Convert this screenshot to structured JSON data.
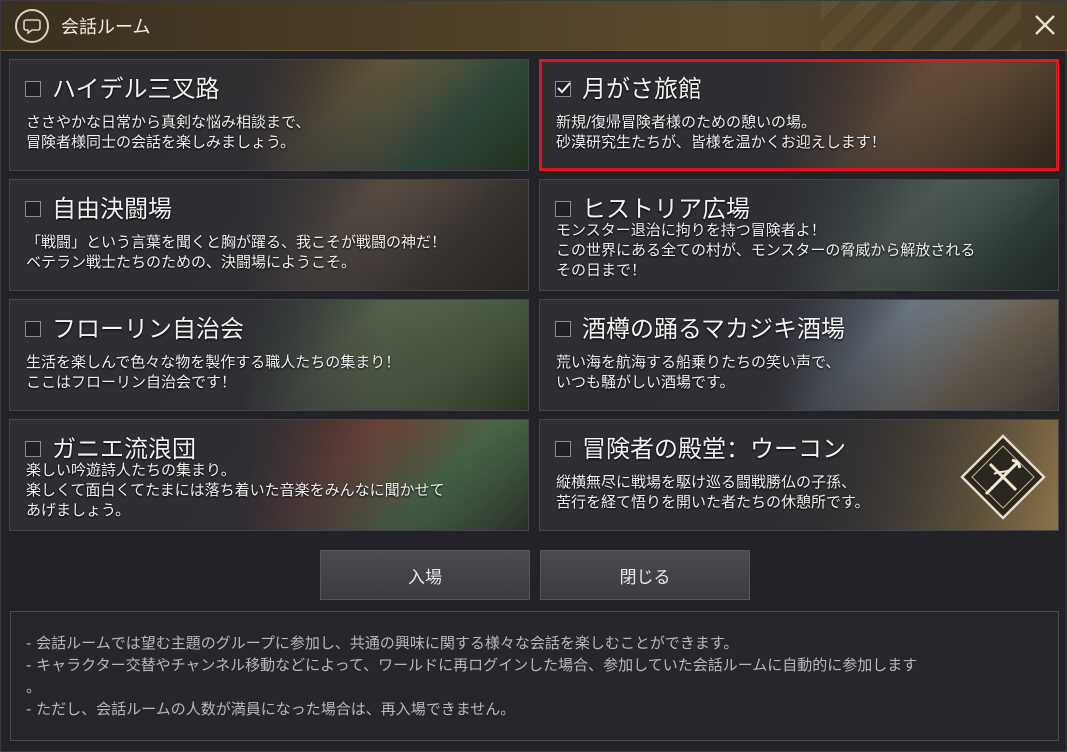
{
  "window": {
    "title": "会話ルーム",
    "title_icon": "speech-bubble-icon",
    "close_icon": "close-icon",
    "accent_color": "#c9a56a",
    "selected_border_color": "#e2151f"
  },
  "rooms": [
    {
      "name": "ハイデル三叉路",
      "checked": false,
      "desc": [
        "ささやかな日常から真剣な悩み相談まで、",
        "冒険者様同士の会話を楽しみましょう。"
      ]
    },
    {
      "name": "月がさ旅館",
      "checked": true,
      "check_icon": "checkmark-icon",
      "desc": [
        "新規/復帰冒険者様のための憩いの場。",
        "砂漠研究生たちが、皆様を温かくお迎えします！"
      ]
    },
    {
      "name": "自由決闘場",
      "checked": false,
      "desc": [
        "「戦闘」という言葉を聞くと胸が躍る、我こそが戦闘の神だ！",
        "ベテラン戦士たちのための、決闘場にようこそ。"
      ]
    },
    {
      "name": "ヒストリア広場",
      "checked": false,
      "desc": [
        "モンスター退治に拘りを持つ冒険者よ！",
        "この世界にある全ての村が、モンスターの脅威から解放される",
        "その日まで！"
      ]
    },
    {
      "name": "フローリン自治会",
      "checked": false,
      "desc": [
        "生活を楽しんで色々な物を製作する職人たちの集まり！",
        "ここはフローリン自治会です！"
      ]
    },
    {
      "name": "酒樽の踊るマカジキ酒場",
      "checked": false,
      "desc": [
        "荒い海を航海する船乗りたちの笑い声で、",
        "いつも騒がしい酒場です。"
      ]
    },
    {
      "name": "ガニエ流浪団",
      "checked": false,
      "desc": [
        "楽しい吟遊詩人たちの集まり。",
        "楽しくて面白くてたまには落ち着いた音楽をみんなに聞かせて",
        "あげましょう。"
      ]
    },
    {
      "name": "冒険者の殿堂：ウーコン",
      "checked": false,
      "emblem_icon": "crossed-weapons-emblem-icon",
      "desc": [
        "縦横無尽に戦場を駆け巡る闘戦勝仏の子孫、",
        "苦行を経て悟りを開いた者たちの休憩所です。"
      ]
    }
  ],
  "buttons": {
    "enter": "入場",
    "close": "閉じる"
  },
  "notes": [
    "- 会話ルームでは望む主題のグループに参加し、共通の興味に関する様々な会話を楽しむことができます。",
    "- キャラクター交替やチャンネル移動などによって、ワールドに再ログインした場合、参加していた会話ルームに自動的に参加します",
    "。",
    "- ただし、会話ルームの人数が満員になった場合は、再入場できません。"
  ]
}
